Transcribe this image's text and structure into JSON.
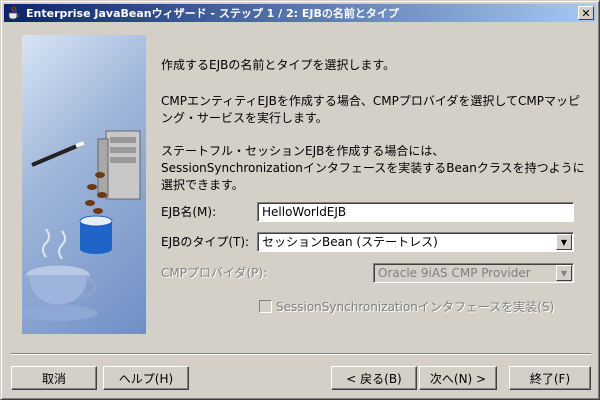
{
  "window": {
    "title": "Enterprise JavaBeanウィザード - ステップ 1 / 2: EJBの名前とタイプ",
    "close_glyph": "✕"
  },
  "intro": {
    "line1": "作成するEJBの名前とタイプを選択します。",
    "line2": "CMPエンティティEJBを作成する場合、CMPプロバイダを選択してCMPマッピング・サービスを実行します。",
    "line3": "ステートフル・セッションEJBを作成する場合には、SessionSynchronizationインタフェースを実装するBeanクラスを持つように選択できます。"
  },
  "form": {
    "ejb_name_label": "EJB名(M):",
    "ejb_name_value": "HelloWorldEJB",
    "ejb_type_label": "EJBのタイプ(T):",
    "ejb_type_value": "セッションBean (ステートレス)",
    "cmp_provider_label": "CMPプロバイダ(P):",
    "cmp_provider_value": "Oracle 9iAS CMP Provider",
    "session_sync_label": "SessionSynchronizationインタフェースを実装(S)"
  },
  "buttons": {
    "cancel": "取消",
    "help": "ヘルプ(H)",
    "back": "< 戻る(B)",
    "next": "次へ(N) >",
    "finish": "終了(F)"
  },
  "colors": {
    "titlebar_start": "#0a246a",
    "titlebar_end": "#a6caf0",
    "dialog_bg": "#d4d0c8"
  }
}
